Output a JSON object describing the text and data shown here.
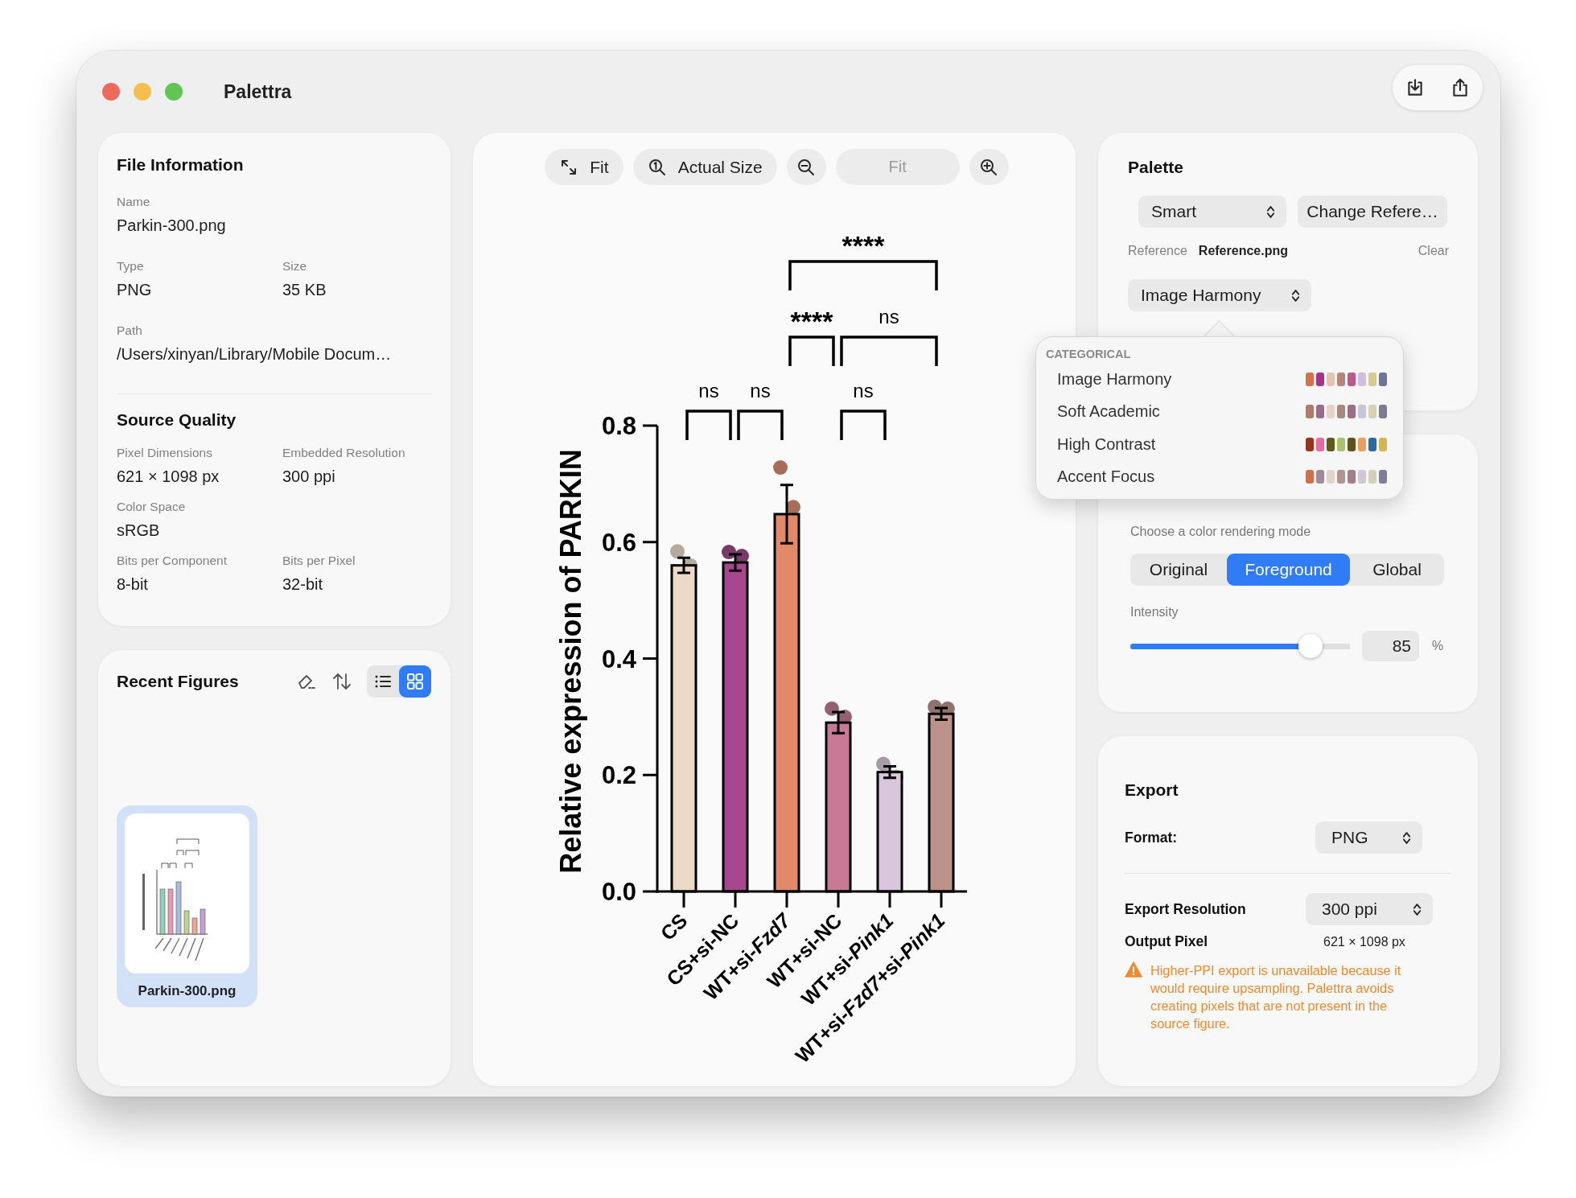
{
  "window": {
    "title": "Palettra"
  },
  "file_information": {
    "title": "File Information",
    "rows": [
      [
        {
          "label": "Name",
          "value": "Parkin-300.png"
        }
      ],
      [
        {
          "label": "Type",
          "value": "PNG"
        },
        {
          "label": "Size",
          "value": "35 KB"
        }
      ],
      [
        {
          "label": "Path",
          "value": "/Users/xinyan/Library/Mobile Docum…"
        }
      ]
    ]
  },
  "source_quality": {
    "title": "Source Quality",
    "rows": [
      [
        {
          "label": "Pixel Dimensions",
          "value": "621 × 1098 px"
        },
        {
          "label": "Embedded Resolution",
          "value": "300 ppi"
        }
      ],
      [
        {
          "label": "Color Space",
          "value": "sRGB"
        }
      ],
      [
        {
          "label": "Bits per Component",
          "value": "8-bit"
        },
        {
          "label": "Bits per Pixel",
          "value": "32-bit"
        }
      ]
    ]
  },
  "recent_figures": {
    "title": "Recent Figures",
    "view_modes": [
      {
        "kind": "list",
        "selected": false
      },
      {
        "kind": "grid",
        "selected": true
      }
    ],
    "items": [
      {
        "name": "Parkin-300.png",
        "selected": true
      }
    ]
  },
  "viewer": {
    "toolbar": [
      {
        "kind": "fit",
        "label": "Fit"
      },
      {
        "kind": "actual_size",
        "label": "Actual Size"
      },
      {
        "kind": "zoom_out"
      },
      {
        "kind": "zoom_field",
        "placeholder": "Fit"
      },
      {
        "kind": "zoom_in"
      }
    ],
    "chart_data": {
      "type": "bar",
      "ylabel": "Relative expression of PARKIN",
      "categories": [
        "CS",
        "CS+si-NC",
        "WT+si-*Fzd7*",
        "WT+si-NC",
        "WT+si-*Pink1*",
        "WT+si-*Fzd7*+si-*Pink1*"
      ],
      "values": [
        0.56,
        0.565,
        0.648,
        0.29,
        0.205,
        0.305
      ],
      "colors": [
        "#ecd9c6",
        "#a8478f",
        "#e2896a",
        "#c97896",
        "#d8c6dd",
        "#bd928a"
      ],
      "errors": [
        0.013,
        0.014,
        0.05,
        0.018,
        0.01,
        0.01
      ],
      "ylim": [
        0,
        0.8
      ],
      "yticks": [
        {
          "value": 0,
          "label": "0.0"
        },
        {
          "value": 0.2,
          "label": "0.2"
        },
        {
          "value": 0.4,
          "label": "0.4"
        },
        {
          "value": 0.6,
          "label": "0.6"
        },
        {
          "value": 0.8,
          "label": "0.8"
        }
      ],
      "annotations": [
        "ns",
        "ns",
        "ns",
        "****",
        "ns",
        "****"
      ]
    }
  },
  "palette": {
    "title": "Palette",
    "mode_dropdown": "Smart",
    "change_reference_button": "Change Refere…",
    "reference_label": "Reference",
    "reference_file": "Reference.png",
    "clear_button": "Clear",
    "scheme_dropdown": "Image Harmony"
  },
  "scheme_menu": {
    "section": "CATEGORICAL",
    "items": [
      {
        "label": "Image Harmony",
        "swatches": [
          {
            "color": "#d4704a"
          },
          {
            "color": "#a8338c"
          },
          {
            "color": "#e2c4b0"
          },
          {
            "color": "#b98577"
          },
          {
            "color": "#c0578b"
          },
          {
            "color": "#cdc0dc"
          },
          {
            "color": "#d8c98e"
          },
          {
            "color": "#6f7499"
          }
        ]
      },
      {
        "label": "Soft Academic",
        "swatches": [
          {
            "color": "#b07a68"
          },
          {
            "color": "#9c6a8a"
          },
          {
            "color": "#e3d3c8"
          },
          {
            "color": "#a8877d"
          },
          {
            "color": "#9d6e86"
          },
          {
            "color": "#cbc3d6"
          },
          {
            "color": "#d9d0b3"
          },
          {
            "color": "#7d7b90"
          }
        ]
      },
      {
        "label": "High Contrast",
        "swatches": [
          {
            "color": "#9a3418"
          },
          {
            "color": "#e86aa2"
          },
          {
            "color": "#5f5a1c"
          },
          {
            "color": "#a9c46d"
          },
          {
            "color": "#5f5318"
          },
          {
            "color": "#e8a060"
          },
          {
            "color": "#2c6aa0"
          },
          {
            "color": "#d4b456"
          }
        ]
      },
      {
        "label": "Accent Focus",
        "swatches": [
          {
            "color": "#d0704a"
          },
          {
            "color": "#a3889c"
          },
          {
            "color": "#e0d4cc"
          },
          {
            "color": "#ac968e"
          },
          {
            "color": "#a57e8e"
          },
          {
            "color": "#cfc8d6"
          },
          {
            "color": "#d5d0ba"
          },
          {
            "color": "#7d8094"
          }
        ]
      }
    ]
  },
  "rendering": {
    "prompt": "Choose a color rendering mode",
    "modes": [
      {
        "label": "Original",
        "selected": false
      },
      {
        "label": "Foreground",
        "selected": true
      },
      {
        "label": "Global",
        "selected": false
      }
    ],
    "intensity": {
      "label": "Intensity",
      "level": 0.82,
      "value": "85",
      "unit": "%"
    }
  },
  "export": {
    "title": "Export",
    "format": {
      "label": "Format:",
      "value": "PNG"
    },
    "resolution": {
      "label": "Export Resolution",
      "value": "300 ppi"
    },
    "output_pixel": {
      "label": "Output Pixel",
      "value": "621 × 1098 px"
    },
    "warning": "Higher-PPI export is unavailable because it would require upsampling. Palettra avoids creating pixels that are not present in the source figure."
  }
}
